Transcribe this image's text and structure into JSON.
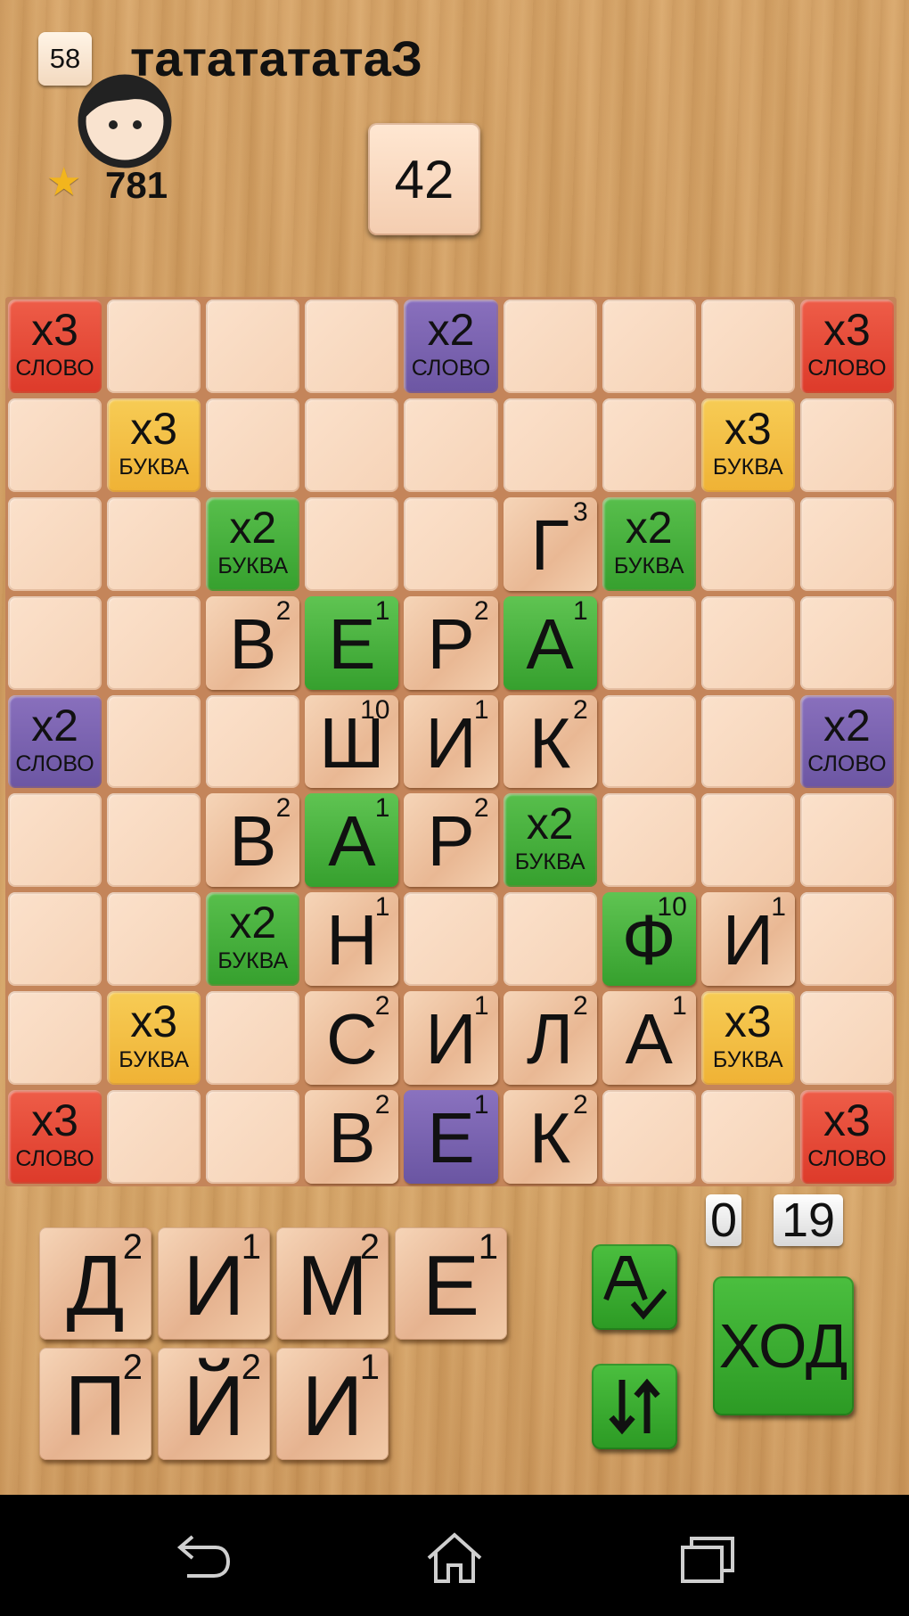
{
  "header": {
    "turn_number": "58",
    "player_name": "тататататаЗ",
    "rating": "781",
    "score": "42"
  },
  "bonus_labels": {
    "word": "СЛОВО",
    "letter": "БУКВА",
    "x2": "x2",
    "x3": "x3"
  },
  "board": [
    [
      {
        "b": "w3"
      },
      {},
      {},
      {},
      {
        "b": "w2"
      },
      {},
      {},
      {},
      {
        "b": "w3"
      }
    ],
    [
      {},
      {
        "b": "l3"
      },
      {},
      {},
      {},
      {},
      {},
      {
        "b": "l3"
      },
      {}
    ],
    [
      {},
      {},
      {
        "b": "l2"
      },
      {},
      {},
      {
        "t": "Г",
        "p": "3"
      },
      {
        "b": "l2"
      },
      {},
      {}
    ],
    [
      {},
      {},
      {
        "t": "В",
        "p": "2"
      },
      {
        "t": "Е",
        "p": "1",
        "b": "l2"
      },
      {
        "t": "Р",
        "p": "2"
      },
      {
        "t": "А",
        "p": "1",
        "b": "l2"
      },
      {},
      {},
      {}
    ],
    [
      {
        "b": "w2"
      },
      {},
      {},
      {
        "t": "Ш",
        "p": "10"
      },
      {
        "t": "И",
        "p": "1"
      },
      {
        "t": "К",
        "p": "2"
      },
      {},
      {},
      {
        "b": "w2"
      }
    ],
    [
      {},
      {},
      {
        "t": "В",
        "p": "2"
      },
      {
        "t": "А",
        "p": "1",
        "b": "l2"
      },
      {
        "t": "Р",
        "p": "2"
      },
      {
        "b": "l2"
      },
      {},
      {},
      {}
    ],
    [
      {},
      {},
      {
        "b": "l2"
      },
      {
        "t": "Н",
        "p": "1"
      },
      {},
      {},
      {
        "t": "Ф",
        "p": "10",
        "b": "l2"
      },
      {
        "t": "И",
        "p": "1"
      },
      {}
    ],
    [
      {},
      {
        "b": "l3"
      },
      {},
      {
        "t": "С",
        "p": "2"
      },
      {
        "t": "И",
        "p": "1"
      },
      {
        "t": "Л",
        "p": "2"
      },
      {
        "t": "А",
        "p": "1"
      },
      {
        "b": "l3"
      },
      {}
    ],
    [
      {
        "b": "w3"
      },
      {},
      {},
      {
        "t": "В",
        "p": "2"
      },
      {
        "t": "Е",
        "p": "1",
        "b": "w2"
      },
      {
        "t": "К",
        "p": "2"
      },
      {},
      {},
      {
        "b": "w3"
      }
    ]
  ],
  "rack": [
    {
      "letter": "Д",
      "points": "2"
    },
    {
      "letter": "И",
      "points": "1"
    },
    {
      "letter": "М",
      "points": "2"
    },
    {
      "letter": "Е",
      "points": "1"
    },
    {
      "letter": "П",
      "points": "2"
    },
    {
      "letter": "Й",
      "points": "2"
    },
    {
      "letter": "И",
      "points": "1"
    }
  ],
  "counters": {
    "left": "0",
    "right": "19"
  },
  "buttons": {
    "move_label": "ХОД",
    "check_icon": "spellcheck-icon",
    "swap_icon": "swap-arrows-icon"
  },
  "navbar": {
    "icons": [
      "back-icon",
      "home-icon",
      "recent-apps-icon"
    ]
  },
  "colors": {
    "word_x3": "#e54a38",
    "word_x2": "#7a63b0",
    "letter_x3": "#f4c046",
    "letter_x2": "#45b03b",
    "tile": "#f0c8a6",
    "board": "#c4855a"
  }
}
